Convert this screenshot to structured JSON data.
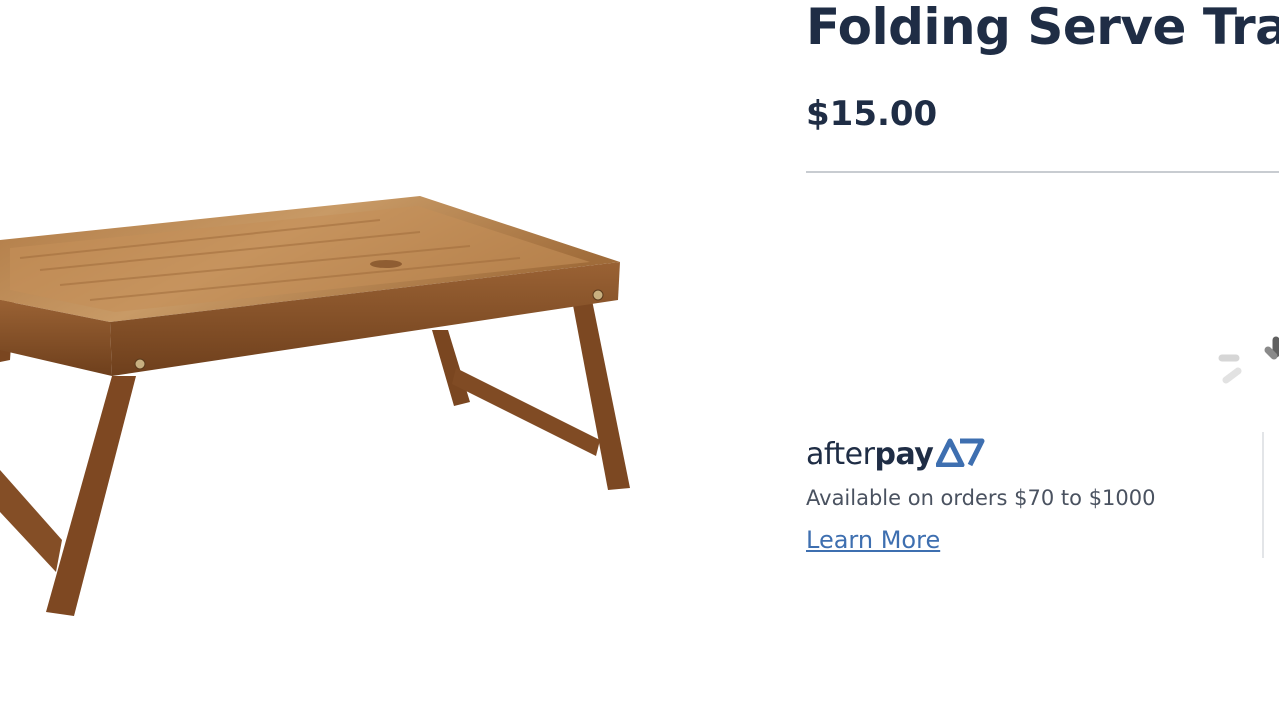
{
  "product": {
    "title": "Folding Serve Tray",
    "price": "$15.00",
    "image_icon": "wooden-folding-serve-tray"
  },
  "afterpay": {
    "brand_light": "after",
    "brand_bold": "pay",
    "icon": "afterpay-arrows-icon",
    "availability": "Available on orders $70 to $1000",
    "learn_more": "Learn More"
  },
  "colors": {
    "text_dark": "#1f2d45",
    "link": "#3e6fb0",
    "wood": "#8a5a30"
  },
  "loading_icon": "spinner-icon"
}
